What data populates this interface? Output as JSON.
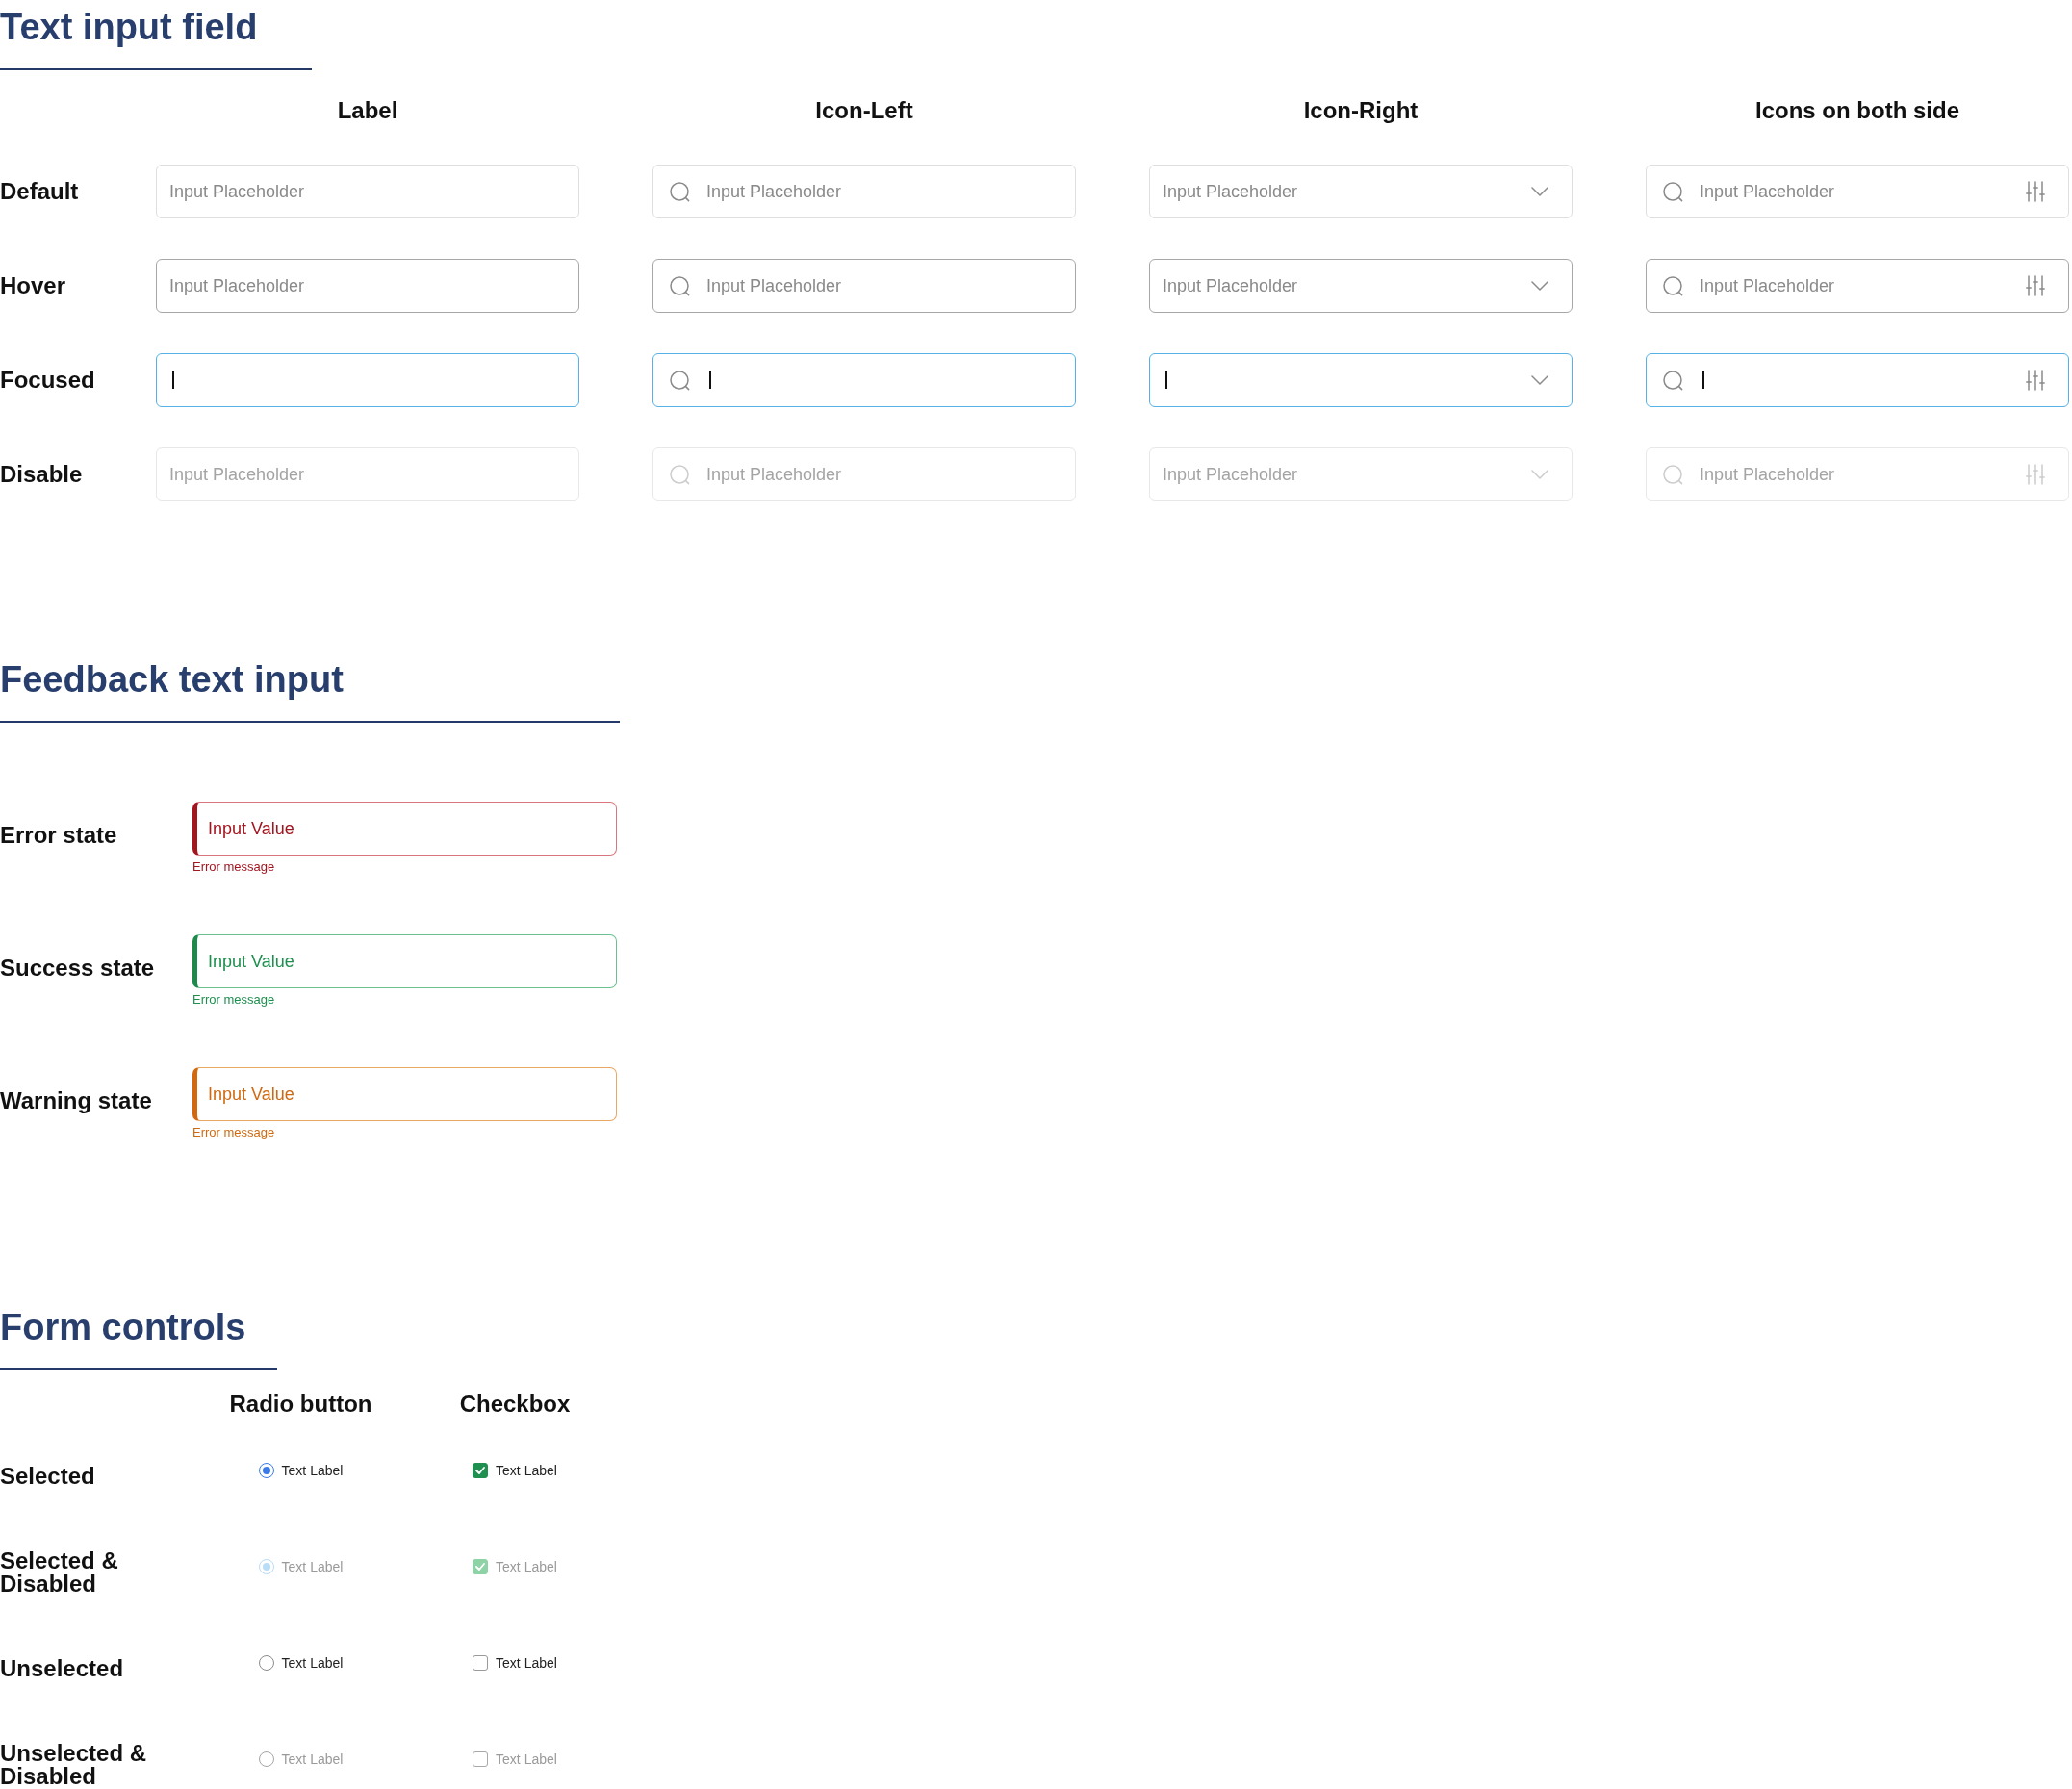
{
  "text_input_field": {
    "title": "Text input field",
    "columns": [
      {
        "heading": "Label",
        "kind": "plain"
      },
      {
        "heading": "Icon-Left",
        "kind": "icon_left"
      },
      {
        "heading": "Icon-Right",
        "kind": "icon_right"
      },
      {
        "heading": "Icons on both side",
        "kind": "icons_both"
      }
    ],
    "rows": [
      {
        "label": "Default",
        "kind": "default",
        "fields": [
          {
            "placeholder": "Input Placeholder"
          },
          {
            "placeholder": "Input Placeholder"
          },
          {
            "placeholder": "Input Placeholder"
          },
          {
            "placeholder": "Input Placeholder"
          }
        ]
      },
      {
        "label": "Hover",
        "kind": "hover",
        "fields": [
          {
            "placeholder": "Input Placeholder"
          },
          {
            "placeholder": "Input Placeholder"
          },
          {
            "placeholder": "Input Placeholder"
          },
          {
            "placeholder": "Input Placeholder"
          }
        ]
      },
      {
        "label": "Focused",
        "kind": "focused"
      },
      {
        "label": "Disable",
        "kind": "disabled",
        "fields": [
          {
            "placeholder": "Input Placeholder"
          },
          {
            "placeholder": "Input Placeholder"
          },
          {
            "placeholder": "Input Placeholder"
          },
          {
            "placeholder": "Input Placeholder"
          }
        ]
      }
    ]
  },
  "feedback_text_input": {
    "title": "Feedback text input",
    "rows": [
      {
        "label": "Error state",
        "kind": "error",
        "value": "Input Value",
        "message": "Error message"
      },
      {
        "label": "Success state",
        "kind": "success",
        "value": "Input Value",
        "message": "Error message"
      },
      {
        "label": "Warning state",
        "kind": "warning",
        "value": "Input Value",
        "message": "Error message"
      }
    ]
  },
  "form_controls": {
    "title": "Form controls",
    "columns": [
      {
        "heading": "Radio button",
        "kind": "radio"
      },
      {
        "heading": "Checkbox",
        "kind": "checkbox"
      }
    ],
    "rows": [
      {
        "label": "Selected",
        "controls": [
          {
            "label": "Text Label",
            "selected": true,
            "disabled": false
          },
          {
            "label": "Text Label",
            "checked": true,
            "disabled": false
          }
        ]
      },
      {
        "label": "Selected & Disabled",
        "controls": [
          {
            "label": "Text Label",
            "selected": true,
            "disabled": true
          },
          {
            "label": "Text Label",
            "checked": true,
            "disabled": true
          }
        ]
      },
      {
        "label": "Unselected",
        "controls": [
          {
            "label": "Text Label",
            "selected": false,
            "disabled": false
          },
          {
            "label": "Text Label",
            "checked": false,
            "disabled": false
          }
        ]
      },
      {
        "label": "Unselected & Disabled",
        "controls": [
          {
            "label": "Text Label",
            "selected": false,
            "disabled": true
          },
          {
            "label": "Text Label",
            "checked": false,
            "disabled": true
          }
        ]
      }
    ]
  }
}
